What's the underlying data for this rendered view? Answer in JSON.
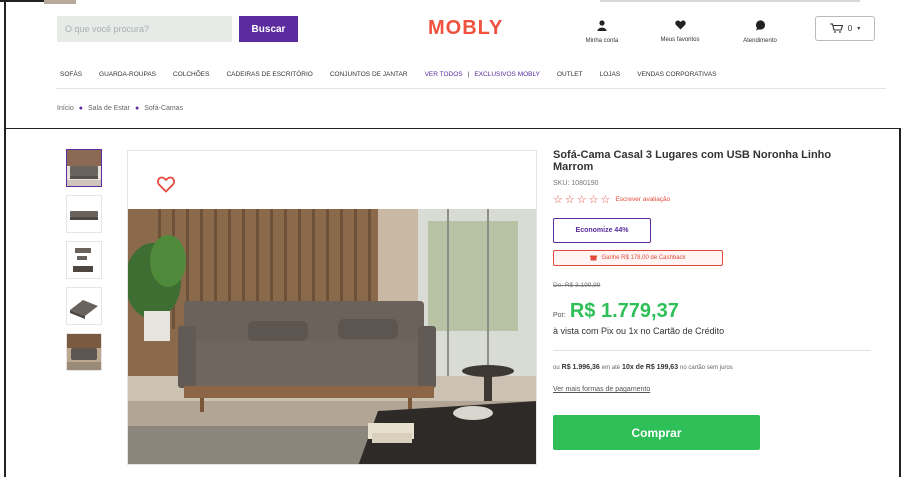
{
  "header": {
    "search_placeholder": "O que você procura?",
    "search_button": "Buscar",
    "logo": "MOBLY",
    "links": [
      {
        "icon": "user-icon",
        "label": "Minha conta"
      },
      {
        "icon": "heart-icon",
        "label": "Meus favoritos"
      },
      {
        "icon": "chat-icon",
        "label": "Atendimento"
      }
    ],
    "cart_count": "0"
  },
  "nav": {
    "items": [
      "SOFÁS",
      "GUARDA-ROUPAS",
      "COLCHÕES",
      "CADEIRAS DE ESCRITÓRIO",
      "CONJUNTOS DE JANTAR"
    ],
    "highlight": "VER TODOS",
    "separator": "|",
    "items2": [
      "EXCLUSIVOS MOBLY",
      "OUTLET",
      "LOJAS",
      "VENDAS CORPORATIVAS"
    ]
  },
  "breadcrumb": [
    "Início",
    "Sala de Estar",
    "Sofá-Camas"
  ],
  "product": {
    "title": "Sofá-Cama Casal 3 Lugares com USB Noronha Linho Marrom",
    "sku": "SKU: 1080190",
    "review_link": "Escrever avaliação",
    "economize": "Economize 44%",
    "coupon": "Ganhe R$ 178,00 de Cashback",
    "old_price": "De: R$ 3.199,99",
    "price_prefix": "Por:",
    "price": "R$ 1.779,37",
    "pix_note": "à vista com Pix ou 1x no Cartão de Crédito",
    "install_prefix": "ou",
    "install_total": "R$ 1.996,36",
    "install_mid": "em até",
    "install_terms": "10x de R$ 199,63",
    "install_suffix": "no cartão sem juros",
    "pay_link": "Ver mais formas de pagamento",
    "buy_button": "Comprar"
  },
  "colors": {
    "brand": "#5a2ca0",
    "logo": "#f0523f",
    "price": "#2fbf59",
    "alert": "#e24b3b"
  }
}
